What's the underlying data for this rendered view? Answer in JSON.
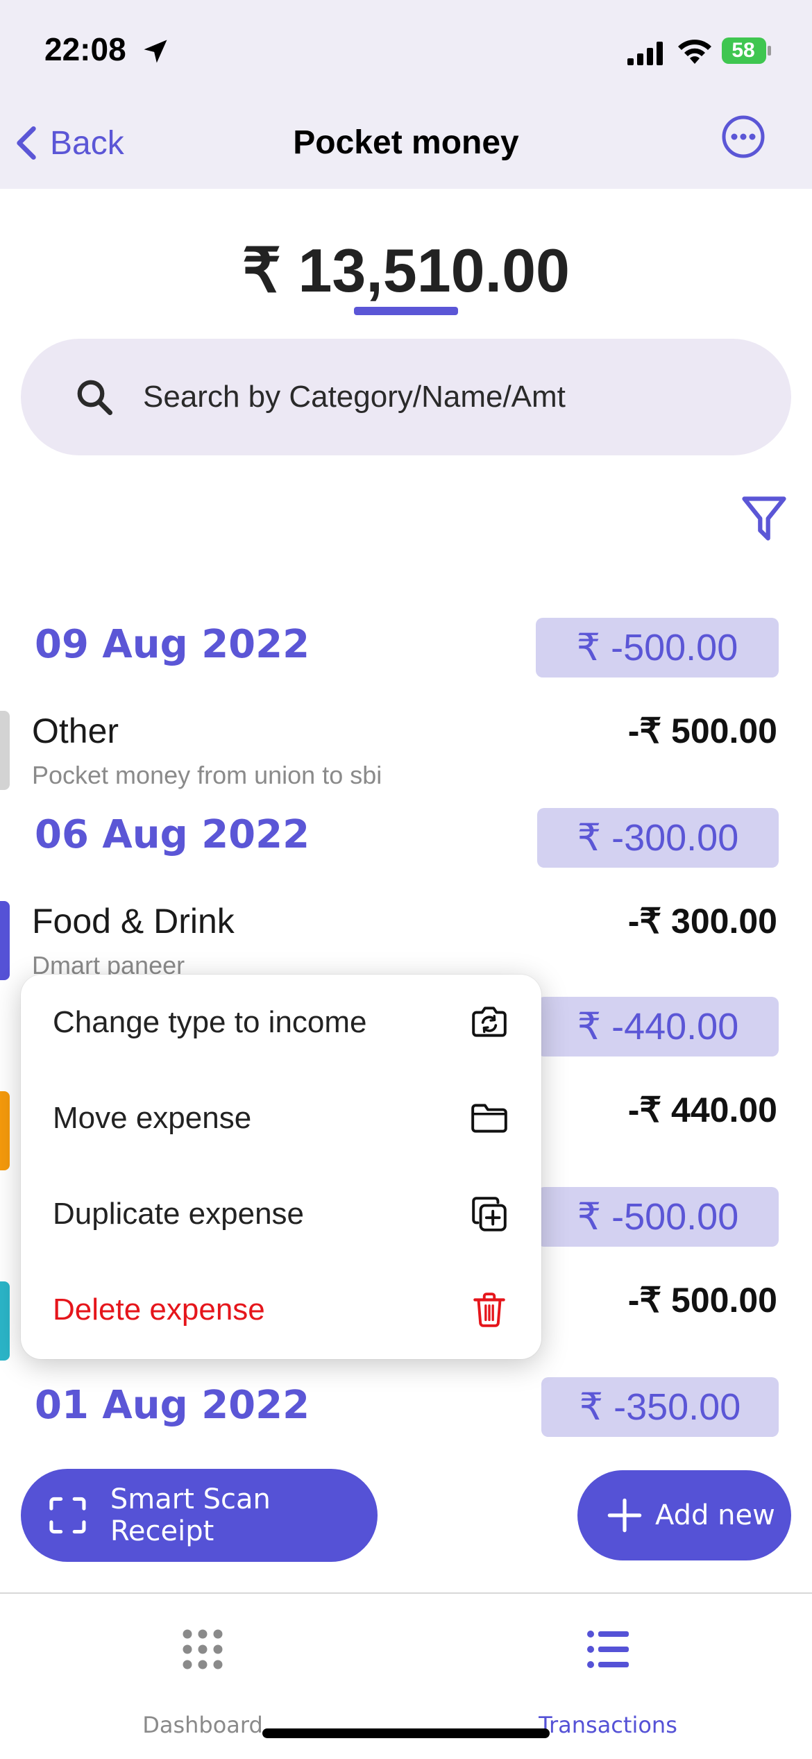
{
  "status_bar": {
    "time": "22:08",
    "battery": "58"
  },
  "header": {
    "back_label": "Back",
    "title": "Pocket money"
  },
  "balance": {
    "amount": "₹ 13,510.00"
  },
  "search": {
    "placeholder": "Search by Category/Name/Amt"
  },
  "groups": [
    {
      "date": "09 Aug 2022",
      "total": "₹ -500.00",
      "txn": {
        "category": "Other",
        "note": "Pocket money from union to sbi",
        "amount": "-₹ 500.00",
        "color": "#d3d3d3"
      }
    },
    {
      "date": "06 Aug 2022",
      "total": "₹ -300.00",
      "txn": {
        "category": "Food & Drink",
        "note": "Dmart paneer",
        "amount": "-₹ 300.00",
        "color": "#5552d6"
      }
    },
    {
      "total": "₹ -440.00",
      "txn": {
        "amount": "-₹ 440.00",
        "color": "#f59a0c"
      }
    },
    {
      "total": "₹ -500.00",
      "txn": {
        "amount": "-₹ 500.00",
        "color": "#2bb5c8"
      }
    },
    {
      "date": "01 Aug 2022",
      "total": "₹ -350.00"
    }
  ],
  "context_menu": {
    "items": [
      {
        "label": "Change type to income",
        "icon": "camera-rotate-icon"
      },
      {
        "label": "Move expense",
        "icon": "folder-icon"
      },
      {
        "label": "Duplicate expense",
        "icon": "duplicate-icon"
      },
      {
        "label": "Delete expense",
        "icon": "trash-icon",
        "color": "#e5151b"
      }
    ]
  },
  "actions": {
    "scan_label": "Smart Scan Receipt",
    "add_label": "Add new"
  },
  "tabs": [
    {
      "label": "Dashboard",
      "icon": "grid-dots-icon",
      "active": false
    },
    {
      "label": "Transactions",
      "icon": "list-icon",
      "active": true
    }
  ],
  "colors": {
    "accent": "#5552d6",
    "header_bg": "#efedf6",
    "danger": "#e5151b"
  }
}
